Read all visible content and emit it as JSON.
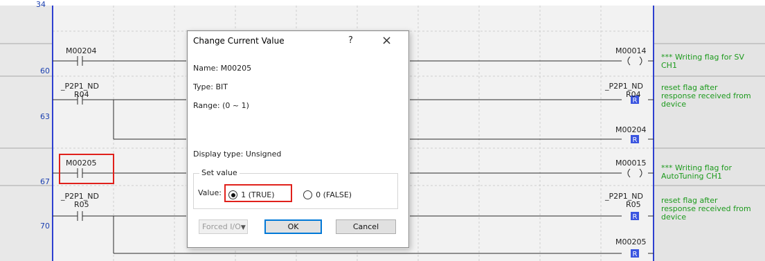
{
  "rungs": {
    "partial_top": "34",
    "r60": "60",
    "r63": "63",
    "r67": "67",
    "r70": "70"
  },
  "contacts": {
    "c60": "M00204",
    "c63_line1": "_P2P1_ND",
    "c63_line2": "R04",
    "c67": "M00205",
    "c70_line1": "_P2P1_ND",
    "c70_line2": "R05"
  },
  "coils": {
    "o60": "M00014",
    "o63_line1": "_P2P1_ND",
    "o63_line2": "R04",
    "o63b": "M00204",
    "o67": "M00015",
    "o70_line1": "_P2P1_ND",
    "o70_line2": "R05",
    "o70b": "M00205"
  },
  "comments": {
    "c60_a": "*** Writing flag for SV",
    "c60_b": "CH1",
    "c63_a": "reset flag after",
    "c63_b": "response received from",
    "c63_c": "device",
    "c67_a": "*** Writing flag for",
    "c67_b": "AutoTuning CH1",
    "c70_a": "reset flag after",
    "c70_b": "response received from",
    "c70_c": "device"
  },
  "dialog": {
    "title": "Change Current Value",
    "help": "?",
    "close": "×",
    "name": "Name:  M00205",
    "type": "Type:  BIT",
    "range": "Range: (0 ~ 1)",
    "display_type": "Display type:  Unsigned",
    "set_value_caption": "Set value",
    "value_label": "Value:",
    "option_true": "1 (TRUE)",
    "option_false": "0 (FALSE)",
    "selected": "1 (TRUE)",
    "forced_io": "Forced I/O",
    "ok": "OK",
    "cancel": "Cancel"
  },
  "colors": {
    "highlight": "#e0201b",
    "rung_number": "#1a3fb0",
    "comment": "#1c9a1c",
    "power_rail": "#2d3fd0",
    "dialog_default_button": "#0078d7"
  }
}
